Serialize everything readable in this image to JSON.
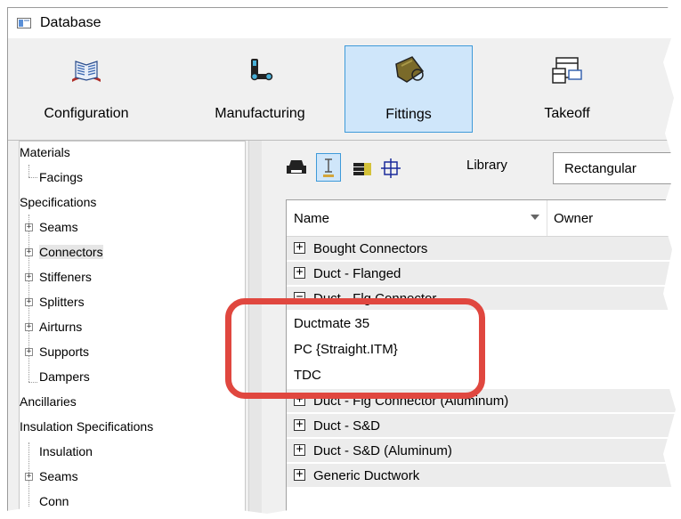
{
  "window": {
    "title": "Database"
  },
  "ribbon": {
    "buttons": [
      {
        "label": "Configuration",
        "icon": "book-icon",
        "active": false
      },
      {
        "label": "Manufacturing",
        "icon": "manufacturing-icon",
        "active": false
      },
      {
        "label": "Fittings",
        "icon": "fitting-icon",
        "active": true
      },
      {
        "label": "Takeoff",
        "icon": "takeoff-icon",
        "active": false
      }
    ]
  },
  "tree": {
    "items": [
      {
        "label": "Materials",
        "level": 0
      },
      {
        "label": "Facings",
        "level": 1,
        "expander": false
      },
      {
        "label": "Specifications",
        "level": 0
      },
      {
        "label": "Seams",
        "level": 1,
        "expander": true
      },
      {
        "label": "Connectors",
        "level": 1,
        "expander": true,
        "selected": true
      },
      {
        "label": "Stiffeners",
        "level": 1,
        "expander": true
      },
      {
        "label": "Splitters",
        "level": 1,
        "expander": true
      },
      {
        "label": "Airturns",
        "level": 1,
        "expander": true
      },
      {
        "label": "Supports",
        "level": 1,
        "expander": true
      },
      {
        "label": "Dampers",
        "level": 1,
        "expander": false
      },
      {
        "label": "Ancillaries",
        "level": 0
      },
      {
        "label": "Insulation Specifications",
        "level": 0
      },
      {
        "label": "Insulation",
        "level": 1,
        "expander": false
      },
      {
        "label": "Seams",
        "level": 1,
        "expander": true
      },
      {
        "label": "Conn",
        "level": 1,
        "expander": false
      }
    ]
  },
  "toolbar": {
    "icons": [
      "print-icon",
      "template-icon",
      "stack-icon",
      "crosshair-icon"
    ],
    "library_label": "Library",
    "library_value": "Rectangular"
  },
  "list": {
    "headers": {
      "name": "Name",
      "owner": "Owner"
    },
    "rows": [
      {
        "type": "group",
        "label": "Bought Connectors",
        "expanded": false
      },
      {
        "type": "group",
        "label": "Duct - Flanged",
        "expanded": false
      },
      {
        "type": "group",
        "label": "Duct - Flg Connector",
        "expanded": true
      },
      {
        "type": "child",
        "label": "Ductmate 35"
      },
      {
        "type": "child",
        "label": "PC {Straight.ITM}"
      },
      {
        "type": "child",
        "label": "TDC"
      },
      {
        "type": "group",
        "label": "Duct - Flg Connector (Aluminum)",
        "expanded": false
      },
      {
        "type": "group",
        "label": "Duct - S&D",
        "expanded": false
      },
      {
        "type": "group",
        "label": "Duct - S&D (Aluminum)",
        "expanded": false
      },
      {
        "type": "group",
        "label": "Generic Ductwork",
        "expanded": false
      }
    ]
  },
  "colors": {
    "accent": "#3e9ad9",
    "selection": "#cfe6fa",
    "highlight_callout": "#e0473f"
  }
}
